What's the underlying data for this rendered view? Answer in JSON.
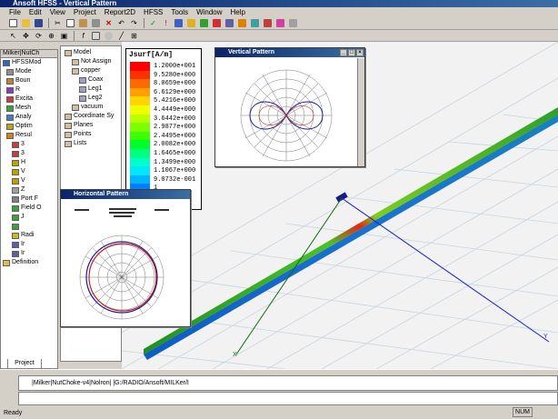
{
  "window": {
    "title": "Ansoft HFSS - Vertical Pattern"
  },
  "menu": [
    "File",
    "Edit",
    "View",
    "Project",
    "Report2D",
    "HFSS",
    "Tools",
    "Window",
    "Help"
  ],
  "left_panel": {
    "header": "Milker|NutCh",
    "items": [
      {
        "label": "HFSSMod",
        "icon": "model-icon"
      },
      {
        "label": "Mode",
        "icon": "mode-icon"
      },
      {
        "label": "Boun",
        "icon": "boundary-icon"
      },
      {
        "label": "R",
        "icon": "radiation-icon"
      },
      {
        "label": "Excita",
        "icon": "excitation-icon"
      },
      {
        "label": "Mesh",
        "icon": "mesh-icon"
      },
      {
        "label": "Analy",
        "icon": "analysis-icon"
      },
      {
        "label": "Optim",
        "icon": "optimetrics-icon"
      },
      {
        "label": "Resul",
        "icon": "results-icon"
      },
      {
        "label": "3",
        "icon": "plot3d-icon"
      },
      {
        "label": "3",
        "icon": "plot3d-icon"
      },
      {
        "label": "H",
        "icon": "polar-icon"
      },
      {
        "label": "V",
        "icon": "polar-icon"
      },
      {
        "label": "V",
        "icon": "polar-icon"
      },
      {
        "label": "Z",
        "icon": "plot-icon"
      },
      {
        "label": "Port F",
        "icon": "port-icon"
      },
      {
        "label": "Field O",
        "icon": "field-icon"
      },
      {
        "label": "J",
        "icon": "field-plot-icon"
      },
      {
        "label": "",
        "icon": "field-plot-icon"
      },
      {
        "label": "Radi",
        "icon": "radiation-icon"
      },
      {
        "label": "Ir",
        "icon": "infinite-sphere-icon"
      },
      {
        "label": "Ir",
        "icon": "infinite-sphere-icon"
      },
      {
        "label": "Definition",
        "icon": "folder-icon"
      }
    ],
    "tab_label": "Project"
  },
  "tree2": {
    "items": [
      {
        "label": "Model",
        "indent": 0
      },
      {
        "label": "Not Assign",
        "indent": 1
      },
      {
        "label": "copper",
        "indent": 1
      },
      {
        "label": "Coax",
        "indent": 2
      },
      {
        "label": "Leg1",
        "indent": 2
      },
      {
        "label": "Leg2",
        "indent": 2
      },
      {
        "label": "vacuum",
        "indent": 1
      },
      {
        "label": "Coordinate Sy",
        "indent": 0
      },
      {
        "label": "Planes",
        "indent": 0
      },
      {
        "label": "Points",
        "indent": 0
      },
      {
        "label": "Lists",
        "indent": 0
      }
    ]
  },
  "legend": {
    "title": "Jsurf[A/m]",
    "values": [
      "1.2000e+001",
      "9.5280e+000",
      "8.0659e+000",
      "6.6129e+000",
      "5.4216e+000",
      "4.4449e+000",
      "3.6442e+000",
      "2.9877e+000",
      "2.4495e+000",
      "2.0082e+000",
      "1.6465e+000",
      "1.3499e+000",
      "1.1067e+000",
      "9.0732e-001",
      "1",
      "1",
      "1"
    ],
    "colors": [
      "#ff0000",
      "#ff3000",
      "#ff6a00",
      "#ffa000",
      "#ffd400",
      "#f0ff00",
      "#b8ff00",
      "#7cff00",
      "#3cff00",
      "#00ff2a",
      "#00ff80",
      "#00ffc8",
      "#00e8ff",
      "#00b4ff",
      "#0080ff",
      "#0048ff",
      "#0010ff"
    ]
  },
  "vertical_pattern": {
    "title": "Vertical Pattern"
  },
  "horizontal_pattern": {
    "title": "Horizontal Pattern"
  },
  "message_bar": "|Milker|NutChoke-v4|Nolron| |G:/RADIO/Ansoft/MILKer/I",
  "status": {
    "text": "Ready",
    "num": "NUM"
  }
}
